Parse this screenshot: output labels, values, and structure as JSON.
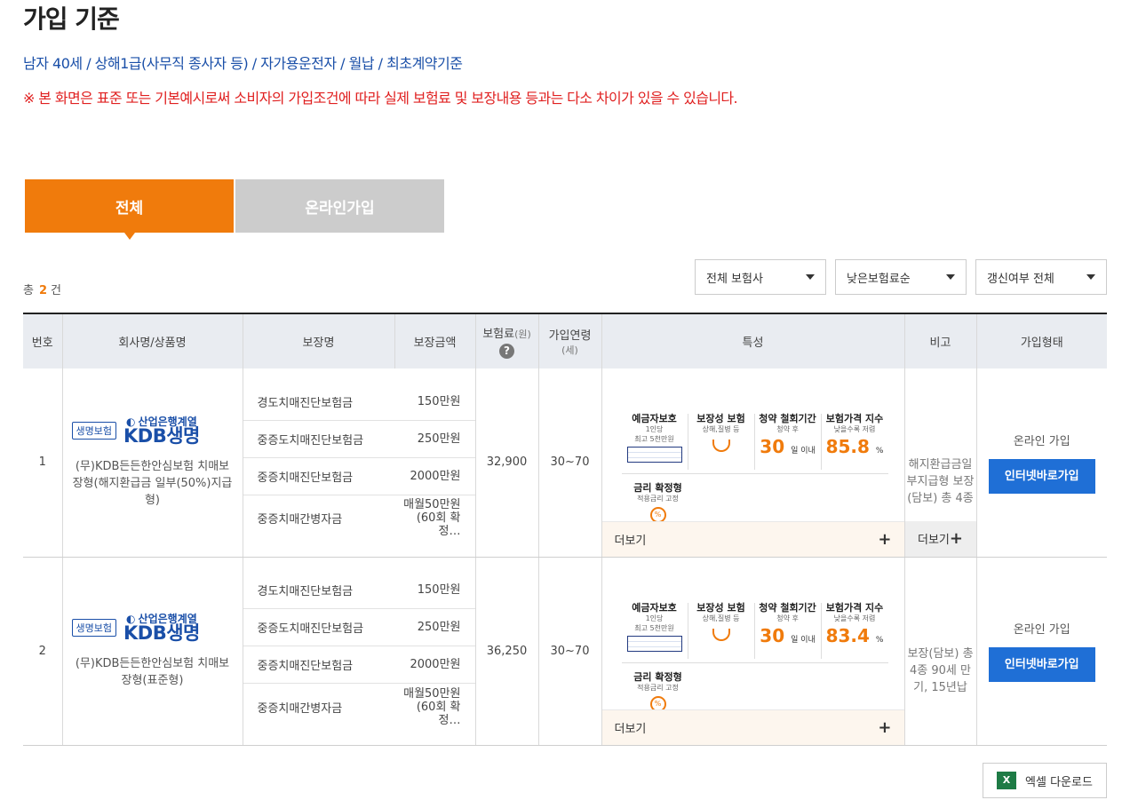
{
  "page": {
    "title": "가입 기준",
    "criteria": "남자 40세 / 상해1급(사무직 종사자 등) / 자가용운전자 / 월납 / 최초계약기준",
    "notice": "※ 본 화면은 표준 또는 기본예시로써 소비자의 가입조건에 따라 실제 보험료 및 보장내용 등과는 다소 차이가 있을 수 있습니다."
  },
  "tabs": [
    {
      "label": "전체",
      "active": true
    },
    {
      "label": "온라인가입",
      "active": false
    }
  ],
  "count": {
    "prefix": "총",
    "value": "2",
    "suffix": "건"
  },
  "filters": {
    "insurer": "전체 보험사",
    "sort": "낮은보험료순",
    "renewal": "갱신여부 전체"
  },
  "table": {
    "headers": {
      "no": "번호",
      "company": "회사명/상품명",
      "coverage": "보장명",
      "amount": "보장금액",
      "premium": "보험료",
      "premium_unit": "(원)",
      "age": "가입연령",
      "age_unit": "(세)",
      "features": "특성",
      "note": "비고",
      "join": "가입형태"
    },
    "rows": [
      {
        "no": "1",
        "tag": "생명보험",
        "brand_top": "산업은행계열",
        "brand_name": "KDB생명",
        "product": "(무)KDB든든한안심보험 치매보장형(해지환급금 일부(50%)지급형)",
        "coverages": [
          {
            "name": "경도치매진단보험금",
            "amount": "150만원"
          },
          {
            "name": "중증도치매진단보험금",
            "amount": "250만원"
          },
          {
            "name": "중증치매진단보험금",
            "amount": "2000만원"
          },
          {
            "name": "중증치매간병자금",
            "amount": "매월50만원 (60회 확정…"
          }
        ],
        "premium": "32,900",
        "age": "30~70",
        "features": {
          "deposit_title": "예금자보호",
          "deposit_sub1": "1인당",
          "deposit_sub2": "최고 5천만원",
          "coverage_title": "보장성 보험",
          "coverage_sub": "상해,질병 등",
          "cancel_title": "청약 철회기간",
          "cancel_sub": "청약 후",
          "cancel_value": "30",
          "cancel_unit": "일 이내",
          "index_title": "보험가격 지수",
          "index_sub": "낮을수록 저렴",
          "index_value": "85.8",
          "index_unit": "%",
          "rate_title": "금리 확정형",
          "rate_sub": "적용금리 고정",
          "rate_icon": "%"
        },
        "more_label": "더보기",
        "note": "해지환급금일부지급형 보장(담보) 총 4종",
        "note_more": "더보기",
        "join_type": "온라인 가입",
        "join_button": "인터넷바로가입"
      },
      {
        "no": "2",
        "tag": "생명보험",
        "brand_top": "산업은행계열",
        "brand_name": "KDB생명",
        "product": "(무)KDB든든한안심보험 치매보장형(표준형)",
        "coverages": [
          {
            "name": "경도치매진단보험금",
            "amount": "150만원"
          },
          {
            "name": "중증도치매진단보험금",
            "amount": "250만원"
          },
          {
            "name": "중증치매진단보험금",
            "amount": "2000만원"
          },
          {
            "name": "중증치매간병자금",
            "amount": "매월50만원 (60회 확정…"
          }
        ],
        "premium": "36,250",
        "age": "30~70",
        "features": {
          "deposit_title": "예금자보호",
          "deposit_sub1": "1인당",
          "deposit_sub2": "최고 5천만원",
          "coverage_title": "보장성 보험",
          "coverage_sub": "상해,질병 등",
          "cancel_title": "청약 철회기간",
          "cancel_sub": "청약 후",
          "cancel_value": "30",
          "cancel_unit": "일 이내",
          "index_title": "보험가격 지수",
          "index_sub": "낮을수록 저렴",
          "index_value": "83.4",
          "index_unit": "%",
          "rate_title": "금리 확정형",
          "rate_sub": "적용금리 고정",
          "rate_icon": "%"
        },
        "more_label": "더보기",
        "note": "보장(담보) 총 4종 90세 만기, 15년납",
        "join_type": "온라인 가입",
        "join_button": "인터넷바로가입"
      }
    ]
  },
  "excel": {
    "label": "엑셀 다운로드",
    "icon": "X"
  },
  "colors": {
    "accent": "#f07b0c",
    "link": "#1a4fa8",
    "warning": "#e02020",
    "button": "#1f6fd6"
  }
}
